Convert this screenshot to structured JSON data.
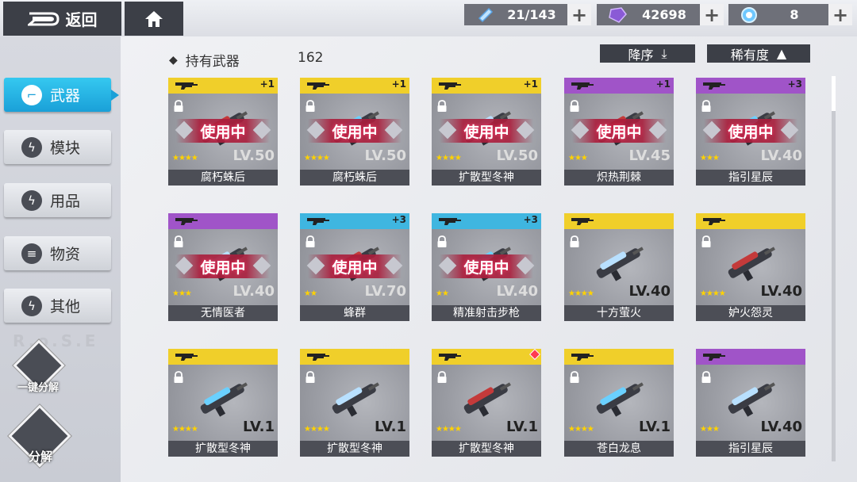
{
  "topbar": {
    "back_label": "返回",
    "resources": [
      {
        "icon": "stamina-icon",
        "value": "21/143"
      },
      {
        "icon": "crystal-icon",
        "value": "42698"
      },
      {
        "icon": "orb-icon",
        "value": "8"
      }
    ]
  },
  "sidebar": {
    "tabs": [
      {
        "label": "武器",
        "icon": "gun-icon",
        "active": true
      },
      {
        "label": "模块",
        "icon": "bolt-icon"
      },
      {
        "label": "用品",
        "icon": "bolt-icon"
      },
      {
        "label": "物资",
        "icon": "stack-icon"
      },
      {
        "label": "其他",
        "icon": "bolt-icon"
      }
    ],
    "watermark": "R.o.S.E",
    "quick_dismantle": "一键分解",
    "dismantle": "分解"
  },
  "header": {
    "section_label": "持有武器",
    "count": "162",
    "sort_label": "降序",
    "rarity_label": "稀有度"
  },
  "weapons": [
    {
      "name": "腐朽蛛后",
      "level": "LV.50",
      "stars": "★★★★",
      "color": "#f0cf2a",
      "plus": "+1",
      "in_use": "使用中"
    },
    {
      "name": "腐朽蛛后",
      "level": "LV.50",
      "stars": "★★★★",
      "color": "#f0cf2a",
      "plus": "+1",
      "in_use": "使用中"
    },
    {
      "name": "扩散型冬神",
      "level": "LV.50",
      "stars": "★★★★",
      "color": "#f0cf2a",
      "plus": "+1",
      "in_use": "使用中"
    },
    {
      "name": "炽热荆棘",
      "level": "LV.45",
      "stars": "★★★",
      "color": "#a054c8",
      "plus": "+1",
      "in_use": "使用中"
    },
    {
      "name": "指引星辰",
      "level": "LV.40",
      "stars": "★★★",
      "color": "#a054c8",
      "plus": "+3",
      "in_use": "使用中"
    },
    {
      "name": "无情医者",
      "level": "LV.40",
      "stars": "★★★",
      "color": "#a054c8",
      "plus": "",
      "in_use": "使用中"
    },
    {
      "name": "蜂群",
      "level": "LV.70",
      "stars": "★★",
      "color": "#3fb6e0",
      "plus": "+3",
      "in_use": "使用中"
    },
    {
      "name": "精准射击步枪",
      "level": "LV.40",
      "stars": "★★",
      "color": "#3fb6e0",
      "plus": "+3",
      "in_use": "使用中"
    },
    {
      "name": "十方萤火",
      "level": "LV.40",
      "stars": "★★★★",
      "color": "#f0cf2a",
      "plus": "",
      "in_use": ""
    },
    {
      "name": "妒火怨灵",
      "level": "LV.40",
      "stars": "★★★★",
      "color": "#f0cf2a",
      "plus": "",
      "in_use": ""
    },
    {
      "name": "扩散型冬神",
      "level": "LV.1",
      "stars": "★★★★",
      "color": "#f0cf2a",
      "plus": "",
      "in_use": ""
    },
    {
      "name": "扩散型冬神",
      "level": "LV.1",
      "stars": "★★★★",
      "color": "#f0cf2a",
      "plus": "",
      "in_use": ""
    },
    {
      "name": "扩散型冬神",
      "level": "LV.1",
      "stars": "★★★★",
      "color": "#f0cf2a",
      "plus": "",
      "in_use": ""
    },
    {
      "name": "苍白龙息",
      "level": "LV.1",
      "stars": "★★★★",
      "color": "#f0cf2a",
      "plus": "",
      "in_use": ""
    },
    {
      "name": "指引星辰",
      "level": "LV.40",
      "stars": "★★★",
      "color": "#a054c8",
      "plus": "",
      "in_use": ""
    }
  ]
}
